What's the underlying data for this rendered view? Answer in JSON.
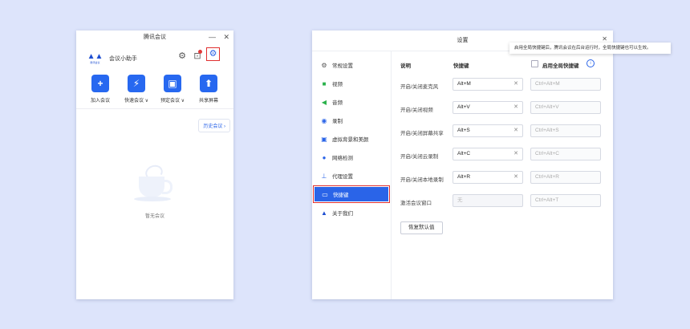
{
  "left_window": {
    "title": "腾讯会议",
    "min": "—",
    "close": "✕",
    "user_name": "会议小助手",
    "avatar_caption": "腾讯会议",
    "actions": [
      {
        "label": "加入会议",
        "icon": "plus-icon",
        "glyph": "+"
      },
      {
        "label": "快速会议 ∨",
        "icon": "lightning-icon",
        "glyph": "⚡"
      },
      {
        "label": "预定会议 ∨",
        "icon": "calendar-icon",
        "glyph": "▣"
      },
      {
        "label": "共享屏幕",
        "icon": "share-screen-icon",
        "glyph": "⬆"
      }
    ],
    "history_btn": "历史会议 ›",
    "empty_text": "暂无会议"
  },
  "right_window": {
    "title": "设置",
    "tooltip": "启用全局快捷键后，腾讯会议在后台运行时，全局快捷键也可以生效。",
    "sidebar": [
      {
        "label": "常规设置",
        "icon": "gear-icon"
      },
      {
        "label": "视频",
        "icon": "video-icon"
      },
      {
        "label": "音频",
        "icon": "audio-icon"
      },
      {
        "label": "录制",
        "icon": "record-icon"
      },
      {
        "label": "虚拟背景和美颜",
        "icon": "portrait-icon"
      },
      {
        "label": "网络检测",
        "icon": "network-icon"
      },
      {
        "label": "代理设置",
        "icon": "proxy-icon"
      },
      {
        "label": "快捷键",
        "icon": "keyboard-icon"
      },
      {
        "label": "关于我们",
        "icon": "logo-icon"
      }
    ],
    "headers": {
      "desc": "说明",
      "shortcut": "快捷键",
      "global": "启用全局快捷键"
    },
    "rows": [
      {
        "label": "开启/关闭麦克风",
        "key": "Alt+M",
        "global": "Ctrl+Alt+M"
      },
      {
        "label": "开启/关闭视频",
        "key": "Alt+V",
        "global": "Ctrl+Alt+V"
      },
      {
        "label": "开启/关闭屏幕共享",
        "key": "Alt+S",
        "global": "Ctrl+Alt+S"
      },
      {
        "label": "开启/关闭云录制",
        "key": "Alt+C",
        "global": "Ctrl+Alt+C"
      },
      {
        "label": "开启/关闭本地录制",
        "key": "Alt+R",
        "global": "Ctrl+Alt+R"
      },
      {
        "label": "激活会议窗口",
        "key": "无",
        "global": "Ctrl+Alt+T"
      }
    ],
    "restore": "恢复默认值",
    "colors": {
      "accent": "#2a64e8",
      "highlight": "#e03030"
    }
  }
}
